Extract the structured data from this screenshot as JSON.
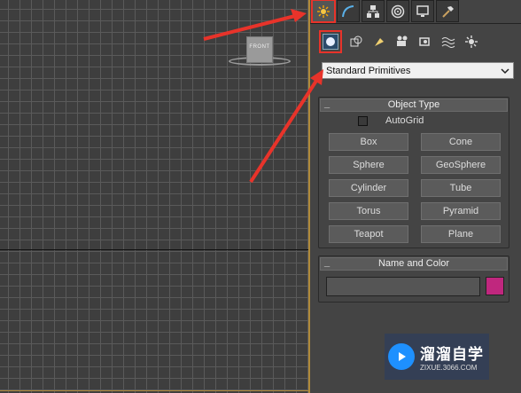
{
  "viewport": {
    "viewcube_label": "FRONT"
  },
  "command_panel": {
    "tabs": [
      {
        "icon": "create-sun-icon",
        "active": true
      },
      {
        "icon": "modify-curve-icon",
        "active": false
      },
      {
        "icon": "hierarchy-icon",
        "active": false
      },
      {
        "icon": "motion-icon",
        "active": false
      },
      {
        "icon": "display-monitor-icon",
        "active": false
      },
      {
        "icon": "utilities-hammer-icon",
        "active": false
      }
    ],
    "subtabs": [
      {
        "icon": "geometry-sphere-icon",
        "active": true
      },
      {
        "icon": "shapes-icon"
      },
      {
        "icon": "lights-icon"
      },
      {
        "icon": "cameras-icon"
      },
      {
        "icon": "helpers-icon"
      },
      {
        "icon": "spacewarps-icon"
      },
      {
        "icon": "systems-icon"
      }
    ],
    "category_dropdown": {
      "selected": "Standard Primitives"
    },
    "object_type": {
      "title": "Object Type",
      "autogrid_label": "AutoGrid",
      "buttons": [
        "Box",
        "Cone",
        "Sphere",
        "GeoSphere",
        "Cylinder",
        "Tube",
        "Torus",
        "Pyramid",
        "Teapot",
        "Plane"
      ]
    },
    "name_and_color": {
      "title": "Name and Color",
      "name_value": "",
      "color": "#c0277e"
    }
  },
  "watermark": {
    "title": "溜溜自学",
    "url": "ZIXUE.3066.COM"
  },
  "colors": {
    "highlight_red": "#e8332a",
    "viewport_border": "#b08a3a"
  }
}
